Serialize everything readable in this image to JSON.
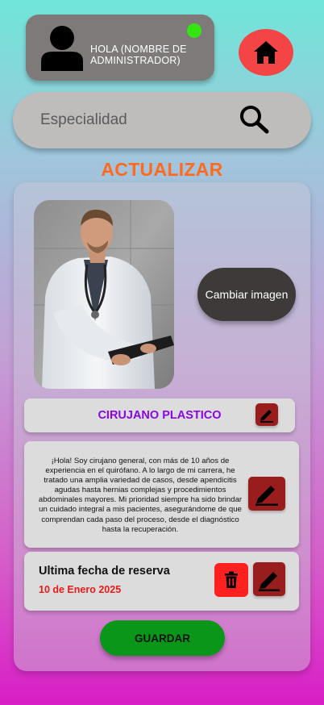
{
  "header": {
    "greeting": "HOLA (NOMBRE DE ADMINISTRADOR)",
    "status_color": "#33e611",
    "home_icon": "home-icon",
    "avatar_icon": "user-icon"
  },
  "search": {
    "placeholder": "Especialidad",
    "icon": "search-icon"
  },
  "page_title": "ACTUALIZAR",
  "profile": {
    "photo_alt": "Foto del doctor",
    "change_image_label": "Cambiar imagen",
    "specialty": "CIRUJANO PLASTICO",
    "bio": "¡Hola! Soy cirujano general, con más de 10 años de experiencia en el quirófano. A lo largo de mi carrera, he tratado una amplia variedad de casos, desde apendicitis agudas hasta hernias complejas y procedimientos abdominales mayores. Mi prioridad siempre ha sido brindar un cuidado integral a mis pacientes, asegurándome de que comprendan cada paso del proceso, desde el diagnóstico hasta la recuperación."
  },
  "reservation": {
    "title": "Ultima fecha de reserva",
    "date": "10 de Enero 2025"
  },
  "actions": {
    "save_label": "GUARDAR"
  },
  "colors": {
    "accent_orange": "#ff6a1f",
    "specialty_purple": "#8a06e4",
    "edit_dark_red": "#9a1d1d",
    "delete_red": "#ff2020",
    "save_green": "#0a9618",
    "home_red": "#f44546"
  }
}
